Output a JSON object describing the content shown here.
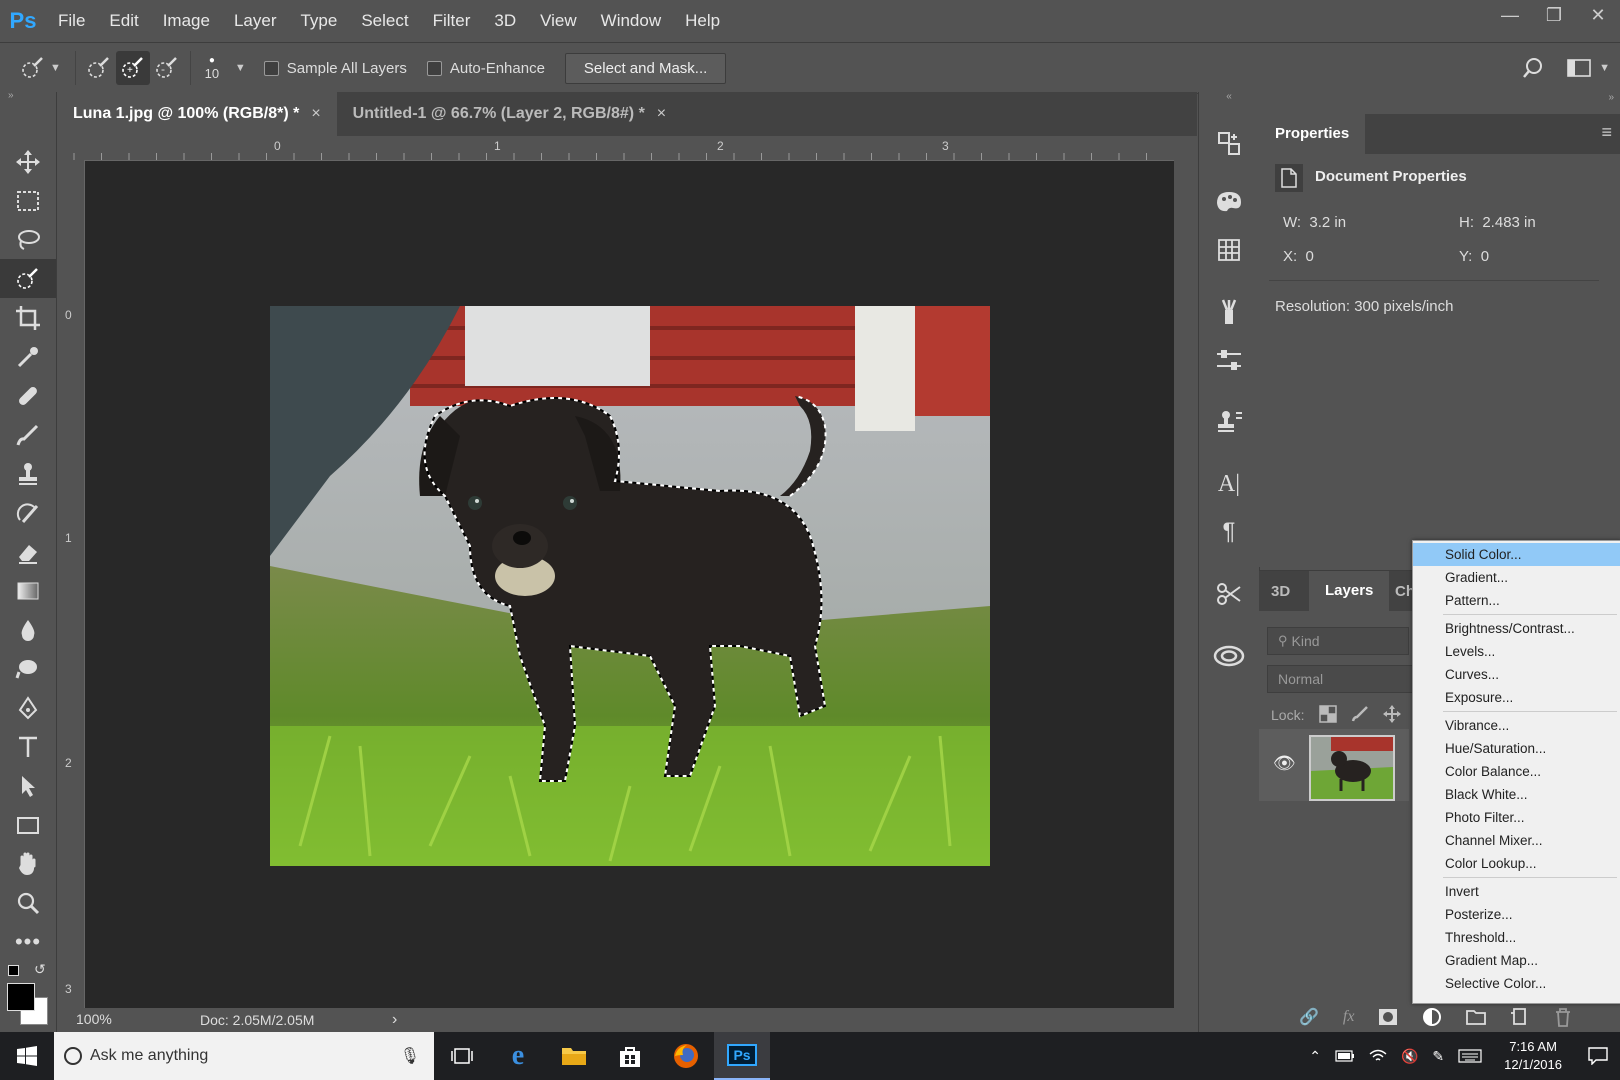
{
  "app": {
    "logo": "Ps"
  },
  "menu": [
    "File",
    "Edit",
    "Image",
    "Layer",
    "Type",
    "Select",
    "Filter",
    "3D",
    "View",
    "Window",
    "Help"
  ],
  "options": {
    "brush_size": "10",
    "sample_all_layers": "Sample All Layers",
    "auto_enhance": "Auto-Enhance",
    "select_mask": "Select and Mask..."
  },
  "tabs": [
    {
      "label": "Luna 1.jpg @ 100% (RGB/8*) *",
      "close": "×"
    },
    {
      "label": "Untitled-1 @ 66.7% (Layer 2, RGB/8#) *",
      "close": "×"
    }
  ],
  "rulers": {
    "top": [
      "0",
      "1",
      "2",
      "3"
    ],
    "left": [
      "0",
      "1",
      "2",
      "3"
    ]
  },
  "status": {
    "zoom": "100%",
    "doc": "Doc: 2.05M/2.05M",
    "arrow": "›"
  },
  "properties": {
    "tab": "Properties",
    "heading": "Document Properties",
    "w_label": "W:",
    "w_value": "3.2 in",
    "h_label": "H:",
    "h_value": "2.483 in",
    "x_label": "X:",
    "x_value": "0",
    "y_label": "Y:",
    "y_value": "0",
    "resolution": "Resolution: 300 pixels/inch"
  },
  "layers_panel": {
    "tabs": [
      "3D",
      "Layers",
      "Ch"
    ],
    "kind_placeholder": "Kind",
    "blend_mode": "Normal",
    "lock_label": "Lock:"
  },
  "adjustments_menu": {
    "group1": [
      "Solid Color...",
      "Gradient...",
      "Pattern..."
    ],
    "group2": [
      "Brightness/Contrast...",
      "Levels...",
      "Curves...",
      "Exposure..."
    ],
    "group3": [
      "Vibrance...",
      "Hue/Saturation...",
      "Color Balance...",
      "Black  White...",
      "Photo Filter...",
      "Channel Mixer...",
      "Color Lookup..."
    ],
    "group4": [
      "Invert",
      "Posterize...",
      "Threshold...",
      "Gradient Map...",
      "Selective Color..."
    ]
  },
  "taskbar": {
    "search_placeholder": "Ask me anything",
    "time": "7:16 AM",
    "date": "12/1/2016",
    "ps_label": "Ps"
  },
  "colors": {
    "ps_blue": "#31a8ff",
    "menu_highlight": "#91c9f7"
  }
}
